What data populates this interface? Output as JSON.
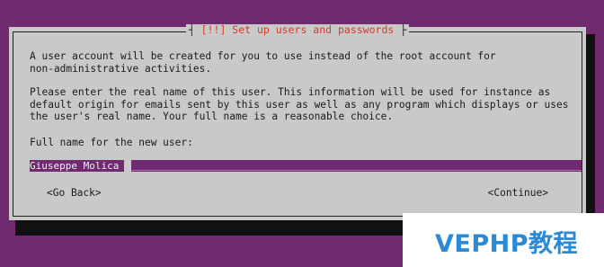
{
  "dialog": {
    "title": "[!!] Set up users and passwords",
    "paragraph1": "A user account will be created for you to use instead of the root account for\nnon-administrative activities.",
    "paragraph2": "Please enter the real name of this user. This information will be used for instance as\ndefault origin for emails sent by this user as well as any program which displays or uses\nthe user's real name. Your full name is a reasonable choice.",
    "field_label": "Full name for the new user:",
    "field_value": "Giuseppe Molica",
    "back_button": "<Go Back>",
    "continue_button": "<Continue>"
  },
  "watermark": "VEPHP教程",
  "colors": {
    "background": "#6f2a70",
    "dialog": "#c9c9c9",
    "title": "#d63b2a",
    "watermark": "#2a8ad6"
  }
}
